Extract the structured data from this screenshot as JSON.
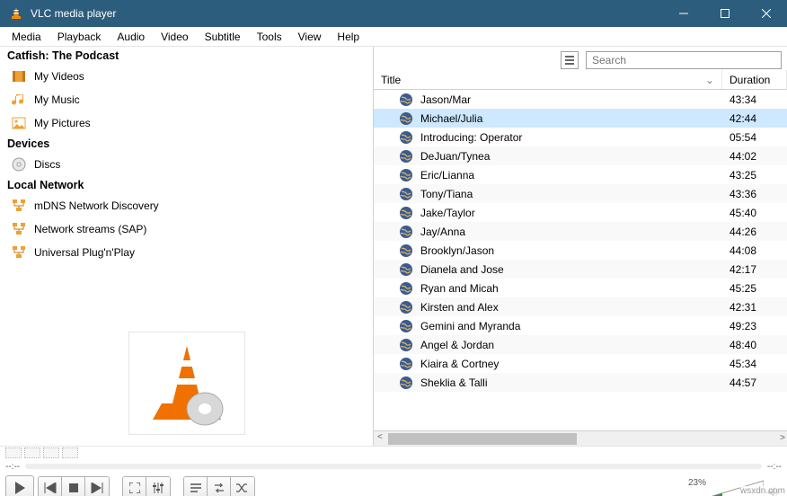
{
  "window": {
    "title": "VLC media player"
  },
  "menus": [
    "Media",
    "Playback",
    "Audio",
    "Video",
    "Subtitle",
    "Tools",
    "View",
    "Help"
  ],
  "sidebar": {
    "top_section": "Catfish: The Podcast",
    "library_items": [
      {
        "label": "My Videos",
        "icon": "film"
      },
      {
        "label": "My Music",
        "icon": "music"
      },
      {
        "label": "My Pictures",
        "icon": "picture"
      }
    ],
    "devices_header": "Devices",
    "devices_items": [
      {
        "label": "Discs",
        "icon": "disc"
      }
    ],
    "network_header": "Local Network",
    "network_items": [
      {
        "label": "mDNS Network Discovery",
        "icon": "net"
      },
      {
        "label": "Network streams (SAP)",
        "icon": "net"
      },
      {
        "label": "Universal Plug'n'Play",
        "icon": "net"
      }
    ]
  },
  "search": {
    "placeholder": "Search",
    "value": ""
  },
  "columns": {
    "title": "Title",
    "duration": "Duration"
  },
  "selected_index": 1,
  "tracks": [
    {
      "title": "Jason/Mar",
      "duration": "43:34"
    },
    {
      "title": "Michael/Julia",
      "duration": "42:44"
    },
    {
      "title": "Introducing: Operator",
      "duration": "05:54"
    },
    {
      "title": "DeJuan/Tynea",
      "duration": "44:02"
    },
    {
      "title": "Eric/Lianna",
      "duration": "43:25"
    },
    {
      "title": "Tony/Tiana",
      "duration": "43:36"
    },
    {
      "title": "Jake/Taylor",
      "duration": "45:40"
    },
    {
      "title": "Jay/Anna",
      "duration": "44:26"
    },
    {
      "title": "Brooklyn/Jason",
      "duration": "44:08"
    },
    {
      "title": "Dianela and Jose",
      "duration": "42:17"
    },
    {
      "title": "Ryan and Micah",
      "duration": "45:25"
    },
    {
      "title": "Kirsten and Alex",
      "duration": "42:31"
    },
    {
      "title": "Gemini and Myranda",
      "duration": "49:23"
    },
    {
      "title": "Angel & Jordan",
      "duration": "48:40"
    },
    {
      "title": "Kiaira & Cortney",
      "duration": "45:34"
    },
    {
      "title": "Sheklia & Talli",
      "duration": "44:57"
    }
  ],
  "seek": {
    "left": "--:--",
    "right": "--:--"
  },
  "volume_pct": "23%",
  "watermark": "wsxdn.com"
}
